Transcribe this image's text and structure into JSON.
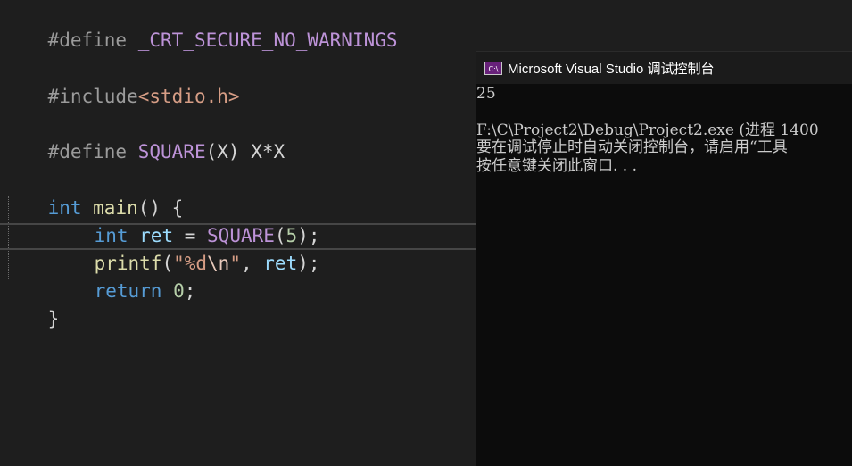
{
  "editor": {
    "lines": [
      {
        "t1": "#define",
        "t2": " _CRT_SECURE_NO_WARNINGS"
      },
      {
        "t1": "#include",
        "t2": "<stdio.h>"
      },
      {
        "t1": "#define",
        "t2": " SQUARE",
        "t3": "(X)",
        "t4": " X*X"
      },
      {
        "t1": "int",
        "t2": " main",
        "t3": "() {"
      },
      {
        "t1": "int",
        "t2": " ret",
        "t3": " = ",
        "t4": "SQUARE",
        "t5": "(",
        "t6": "5",
        "t7": ");"
      },
      {
        "t1": "printf",
        "t2": "(",
        "t3": "\"%d",
        "t4": "\\n",
        "t5": "\"",
        "t6": ", ",
        "t7": "ret",
        "t8": ");"
      },
      {
        "t1": "return",
        "t2": " ",
        "t3": "0",
        "t4": ";"
      },
      {
        "t1": "}"
      }
    ]
  },
  "console": {
    "icon_text": "C:\\",
    "title": "Microsoft Visual Studio 调试控制台",
    "output": [
      "25",
      "",
      "F:\\C\\Project2\\Debug\\Project2.exe (进程 1400",
      "要在调试停止时自动关闭控制台，请启用“工具",
      "按任意键关闭此窗口. . ."
    ]
  }
}
